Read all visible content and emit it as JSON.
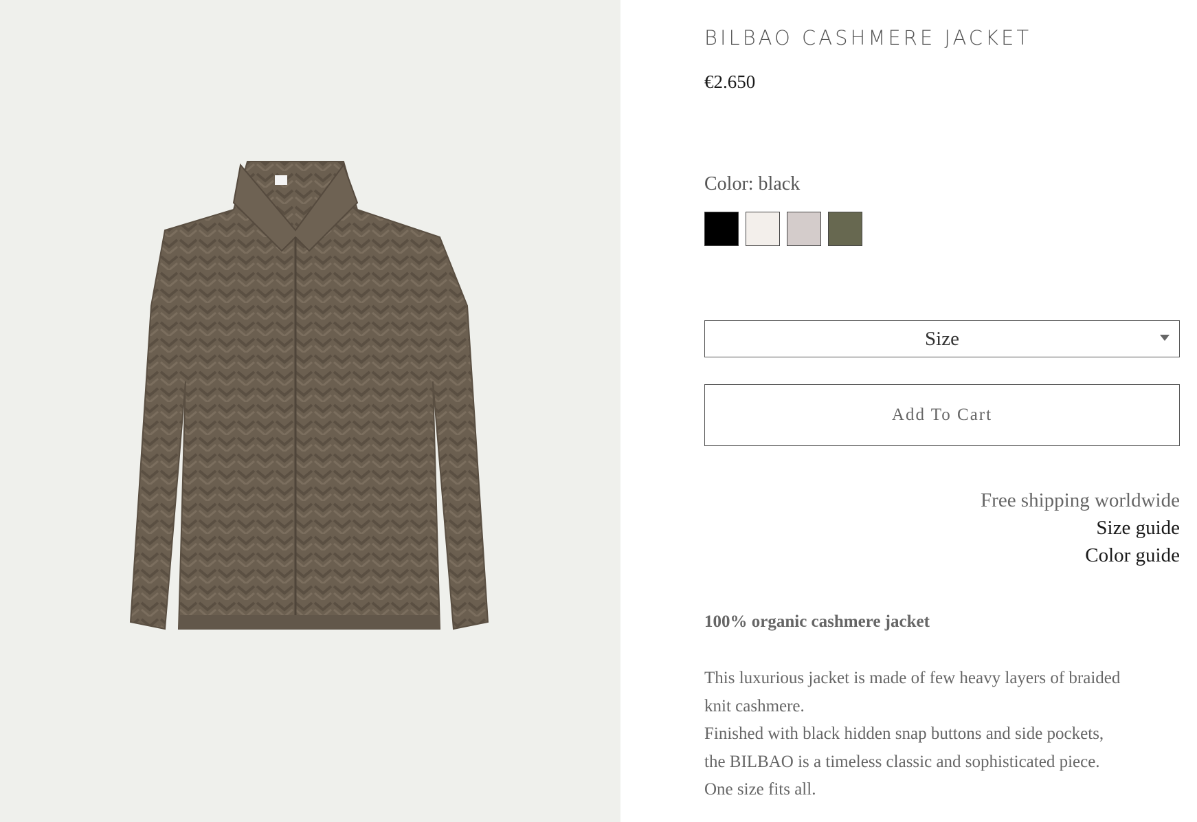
{
  "product": {
    "title": "BILBAO CASHMERE JACKET",
    "price": "€2.650",
    "image_alt": "Bilbao cashmere jacket product photo"
  },
  "color": {
    "label": "Color: black",
    "swatches": [
      {
        "name": "black",
        "hex": "#000000"
      },
      {
        "name": "white",
        "hex": "#f3efeb"
      },
      {
        "name": "grey",
        "hex": "#d4cccb"
      },
      {
        "name": "olive",
        "hex": "#676850"
      }
    ]
  },
  "size": {
    "label": "Size"
  },
  "cart": {
    "label": "Add To Cart"
  },
  "links": {
    "shipping": "Free shipping worldwide",
    "size_guide": "Size guide",
    "color_guide": "Color guide"
  },
  "description": {
    "heading": "100% organic cashmere jacket",
    "lines": [
      "This luxurious jacket is made of few heavy layers of braided",
      "knit cashmere.",
      "Finished with black hidden snap buttons and side pockets,",
      "the BILBAO is a timeless classic and sophisticated piece.",
      "One size fits all."
    ]
  }
}
